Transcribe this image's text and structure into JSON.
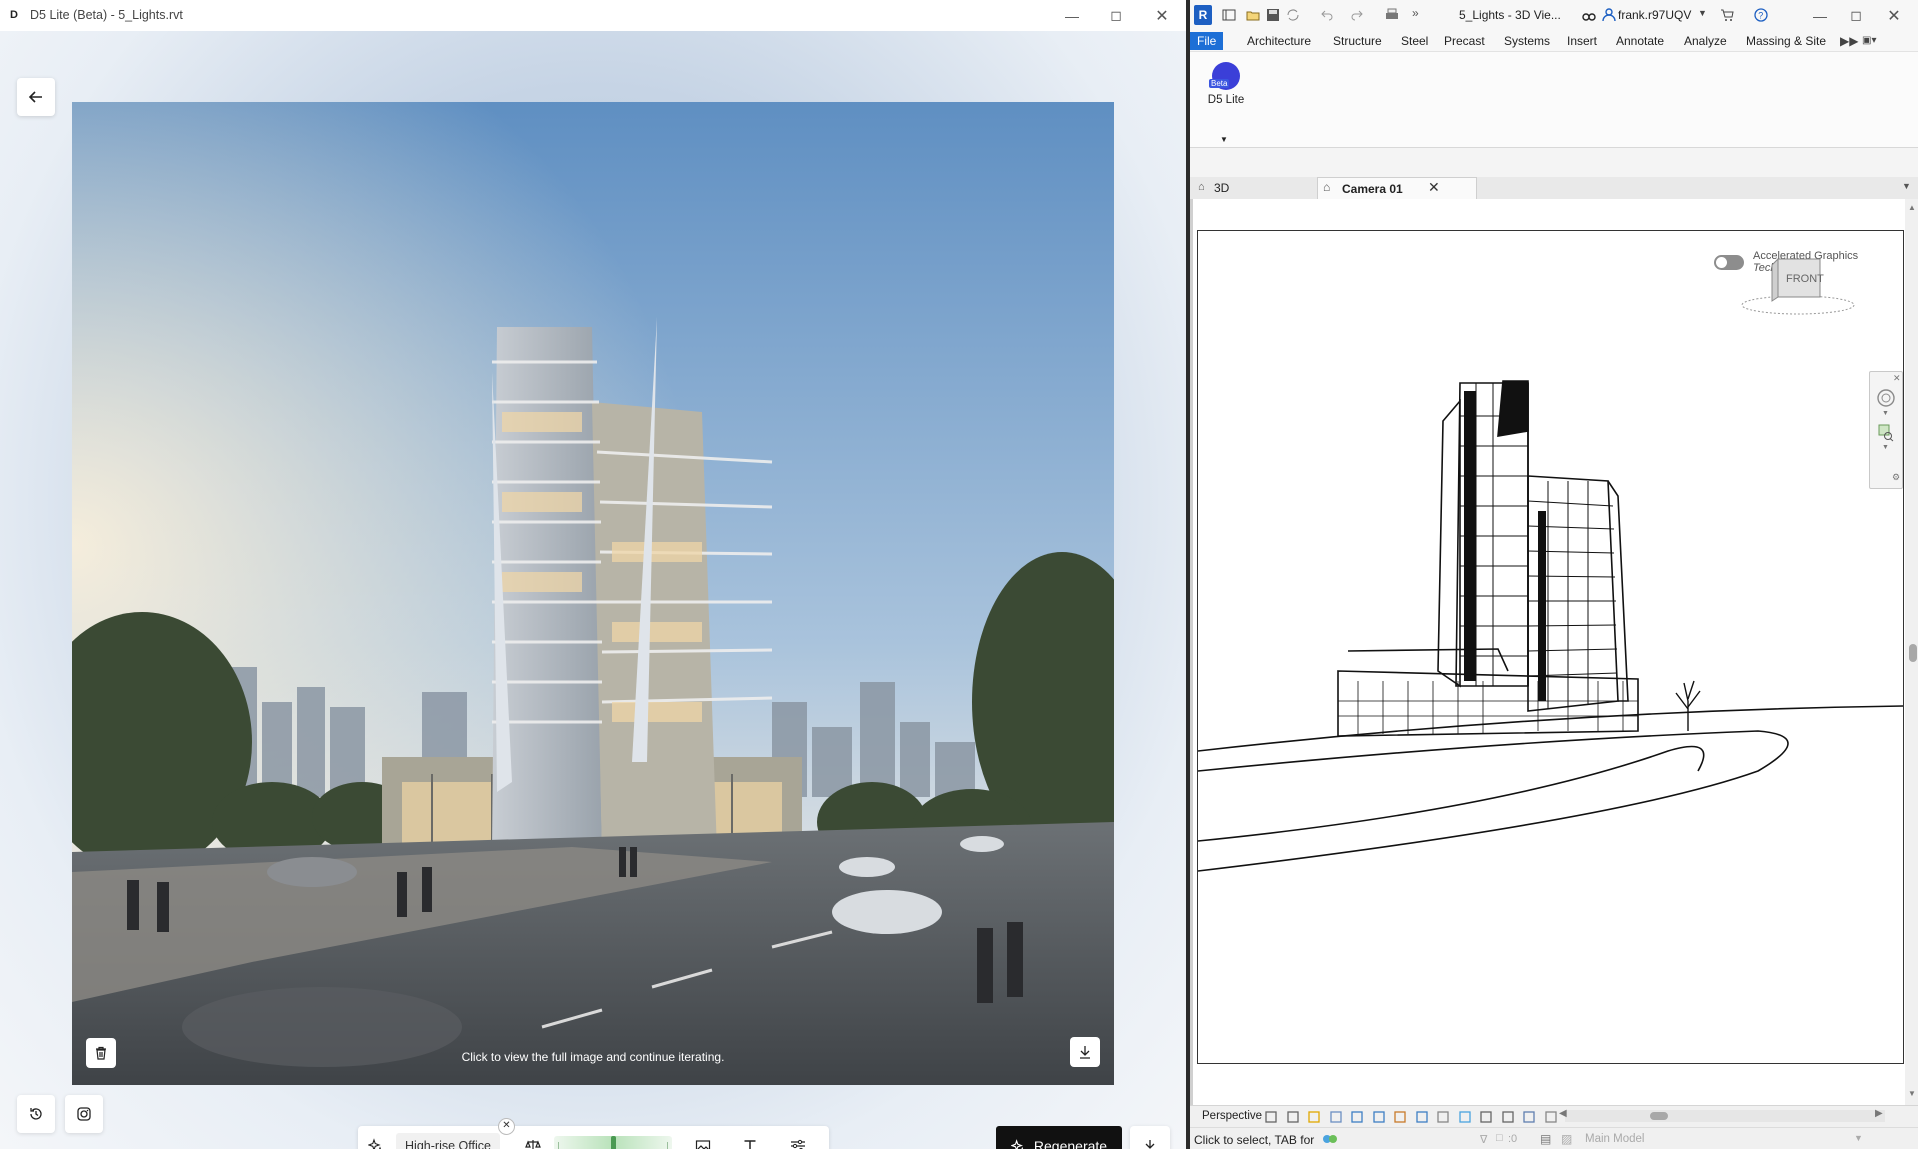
{
  "d5": {
    "window_title": "D5 Lite (Beta) - 5_Lights.rvt",
    "caption": "Click to view the full image and continue iterating.",
    "style_chip": "High-rise Office",
    "strength": 0.5,
    "regenerate_label": "Regenerate",
    "icons": [
      "back-arrow-icon",
      "trash-icon",
      "download-icon",
      "history-icon",
      "camera-icon",
      "sparkle-icon",
      "balance-icon",
      "image-icon",
      "text-icon",
      "sliders-icon",
      "export-icon"
    ]
  },
  "revit": {
    "app_logo": "R",
    "document_title": "5_Lights - 3D Vie...",
    "user": "frank.r97UQV",
    "ribbon_tabs": [
      "File",
      "Architecture",
      "Structure",
      "Steel",
      "Precast",
      "Systems",
      "Insert",
      "Annotate",
      "Analyze",
      "Massing & Site"
    ],
    "addin_label": "D5 Lite",
    "addin_badge": "Beta",
    "view_tabs": [
      "3D",
      "Camera 01"
    ],
    "active_view": "Camera 01",
    "accelerated_graphics": "Accelerated Graphics",
    "tech_preview": "Tech Preview",
    "viewcube_label": "FRONT",
    "view_mode": "Perspective",
    "status_text": "Click to select, TAB for",
    "selection_count": ":0",
    "model_selector": "Main Model"
  }
}
